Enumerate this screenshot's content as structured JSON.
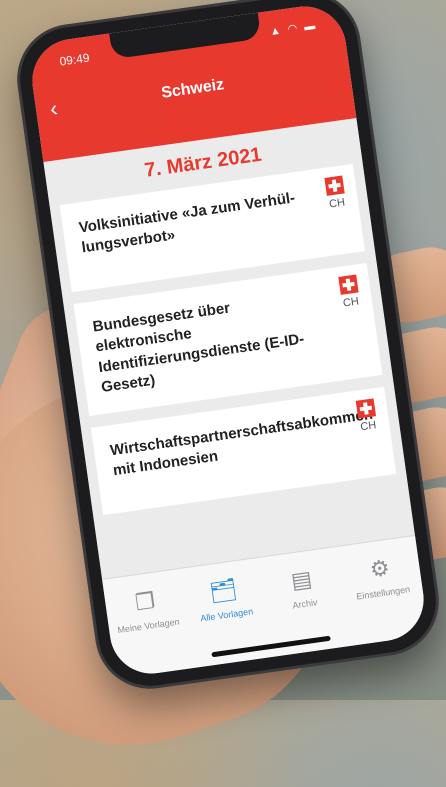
{
  "status_bar": {
    "time": "09:49",
    "icons": "▲ ◠ ▬"
  },
  "header": {
    "title": "Schweiz",
    "back_icon": "chevron-left"
  },
  "date": "7. März 2021",
  "votes": [
    {
      "title": "Volksinitiative «Ja zum Verhül-lungsverbot»",
      "canton": "CH"
    },
    {
      "title": "Bundesgesetz über elektronische Identifizierungsdienste (E-ID-Gesetz)",
      "canton": "CH"
    },
    {
      "title": "Wirtschaftspartnerschaftsabkommen mit Indonesien",
      "canton": "CH"
    }
  ],
  "tabs": [
    {
      "label": "Meine Vorlagen",
      "icon": "my-documents-icon",
      "glyph": "❐",
      "active": false
    },
    {
      "label": "Alle Vorlagen",
      "icon": "all-documents-icon",
      "glyph": "🗂",
      "active": true
    },
    {
      "label": "Archiv",
      "icon": "archive-icon",
      "glyph": "▤",
      "active": false
    },
    {
      "label": "Einstellungen",
      "icon": "gear-icon",
      "glyph": "⚙",
      "active": false
    }
  ],
  "colors": {
    "accent": "#e8392f",
    "tab_active": "#2e8fd6",
    "background": "#ebebeb"
  }
}
